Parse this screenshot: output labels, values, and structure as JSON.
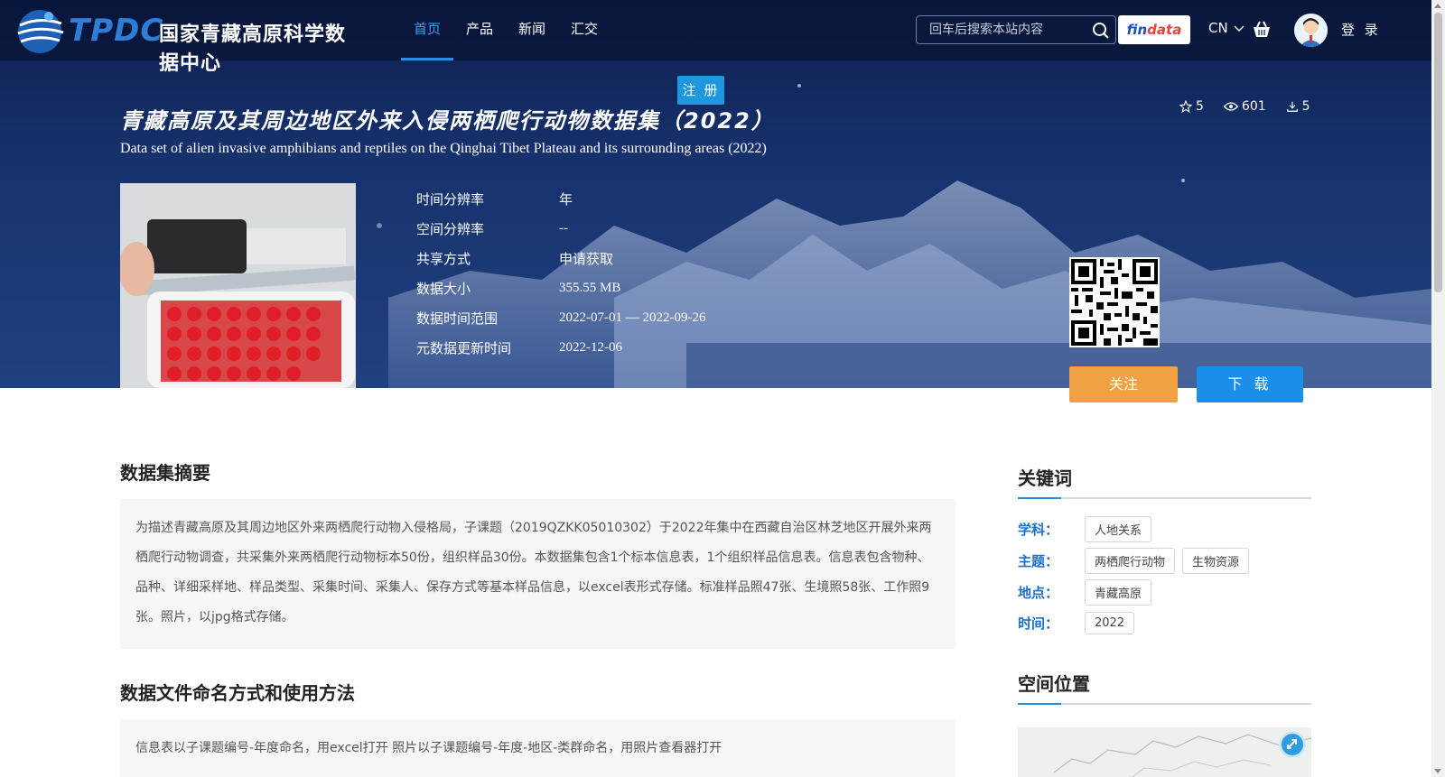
{
  "brand": {
    "logo_en": "TPDC",
    "logo_cn": "国家青藏高原科学数据中心"
  },
  "nav": {
    "items": [
      "首页",
      "产品",
      "新闻",
      "汇交"
    ],
    "active": "首页"
  },
  "search": {
    "placeholder": "回车后搜索本站内容"
  },
  "findata": {
    "part1": "fin",
    "part2": "data"
  },
  "lang": "CN",
  "login": "登 录",
  "register": "注 册",
  "dataset": {
    "title": "青藏高原及其周边地区外来入侵两栖爬行动物数据集（2022）",
    "subtitle": "Data set of alien invasive amphibians and reptiles on the Qinghai Tibet Plateau and its surrounding areas (2022)",
    "stats": {
      "stars": "5",
      "views": "601",
      "downloads": "5"
    },
    "meta": [
      {
        "key": "时间分辨率",
        "value": "年"
      },
      {
        "key": "空间分辨率",
        "value": "--"
      },
      {
        "key": "共享方式",
        "value": "申请获取"
      },
      {
        "key": "数据大小",
        "value": "355.55 MB"
      },
      {
        "key": "数据时间范围",
        "value": "2022-07-01 — 2022-09-26"
      },
      {
        "key": "元数据更新时间",
        "value": "2022-12-06"
      }
    ],
    "follow_label": "关注",
    "download_label": "下 载"
  },
  "abstract": {
    "title": "数据集摘要",
    "text": "为描述青藏高原及其周边地区外来两栖爬行动物入侵格局，子课题（2019QZKK05010302）于2022年集中在西藏自治区林芝地区开展外来两栖爬行动物调查，共采集外来两栖爬行动物标本50份，组织样品30份。本数据集包含1个标本信息表，1个组织样品信息表。信息表包含物种、品种、详细采样地、样品类型、采集时间、采集人、保存方式等基本样品信息，以excel表形式存储。标准样品照47张、生境照58张、工作照9张。照片，以jpg格式存储。"
  },
  "naming": {
    "title": "数据文件命名方式和使用方法",
    "text": "信息表以子课题编号-年度命名，用excel打开 照片以子课题编号-年度-地区-类群命名，用照片查看器打开"
  },
  "keywords": {
    "title": "关键词",
    "rows": [
      {
        "label": "学科：",
        "tags": [
          "人地关系"
        ]
      },
      {
        "label": "主题：",
        "tags": [
          "两栖爬行动物",
          "生物资源"
        ]
      },
      {
        "label": "地点：",
        "tags": [
          "青藏高原"
        ]
      },
      {
        "label": "时间：",
        "tags": [
          "2022"
        ]
      }
    ]
  },
  "location": {
    "title": "空间位置"
  },
  "colors": {
    "accent": "#1a8ee8",
    "follow": "#f0a142",
    "nav_active": "#3aa0f5"
  }
}
